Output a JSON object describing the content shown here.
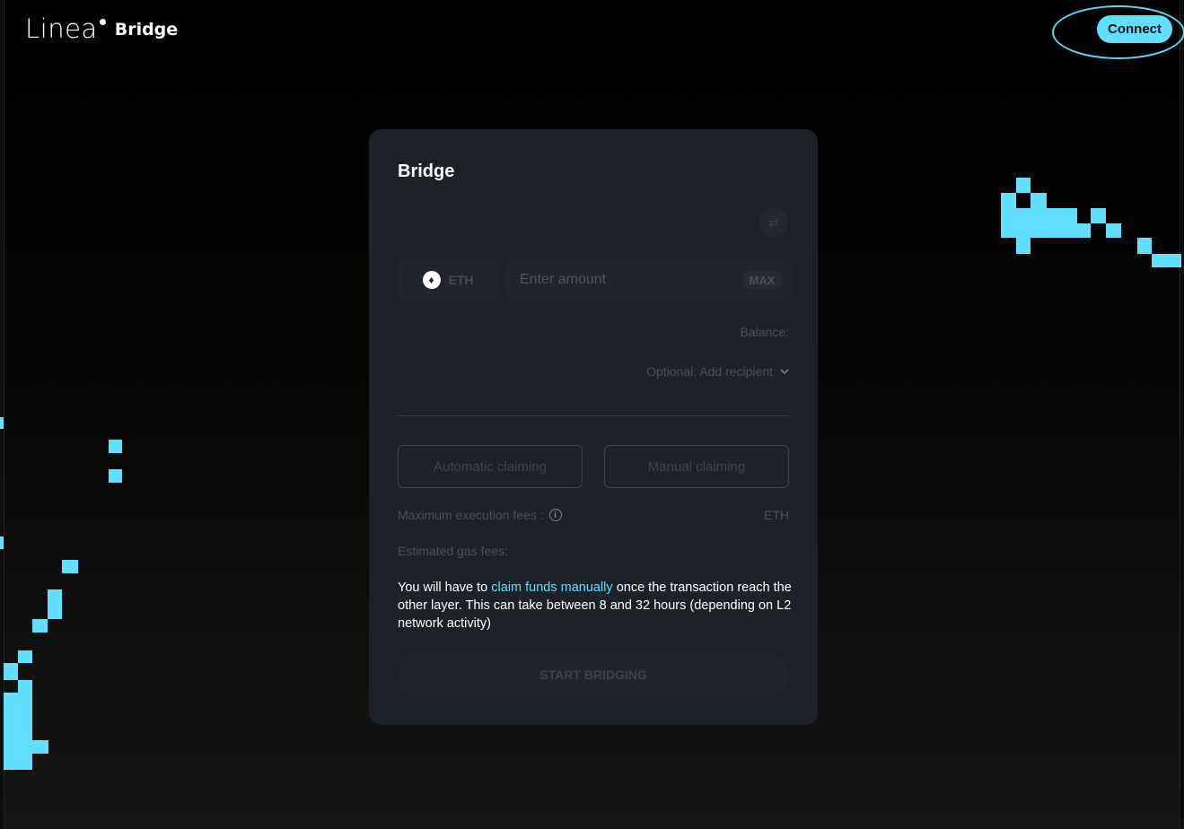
{
  "header": {
    "logo_text": "Linea",
    "product_label": "Bridge",
    "connect_label": "Connect"
  },
  "card": {
    "title": "Bridge",
    "token_symbol": "ETH",
    "amount_placeholder": "Enter amount",
    "max_label": "MAX",
    "balance_label": "Balance:",
    "recipient_label": "Optional: Add recipient",
    "automatic_claiming_label": "Automatic claiming",
    "manual_claiming_label": "Manual claiming",
    "max_fees_label": "Maximum execution fees :",
    "max_fees_unit": "ETH",
    "gas_fees_label": "Estimated gas fees:",
    "notice_prefix": "You will have to ",
    "notice_link": "claim funds manually",
    "notice_suffix": " once the transaction reach the other layer. This can take between 8 and 32 hours (depending on L2 network activity)",
    "start_label": "START BRIDGING"
  },
  "colors": {
    "accent": "#61dfff",
    "card_bg": "#1d2128",
    "page_bg": "#000000"
  },
  "icons": {
    "eth": "ethereum-icon",
    "swap": "swap-direction-icon",
    "chevron": "chevron-down-icon",
    "info": "info-icon"
  }
}
